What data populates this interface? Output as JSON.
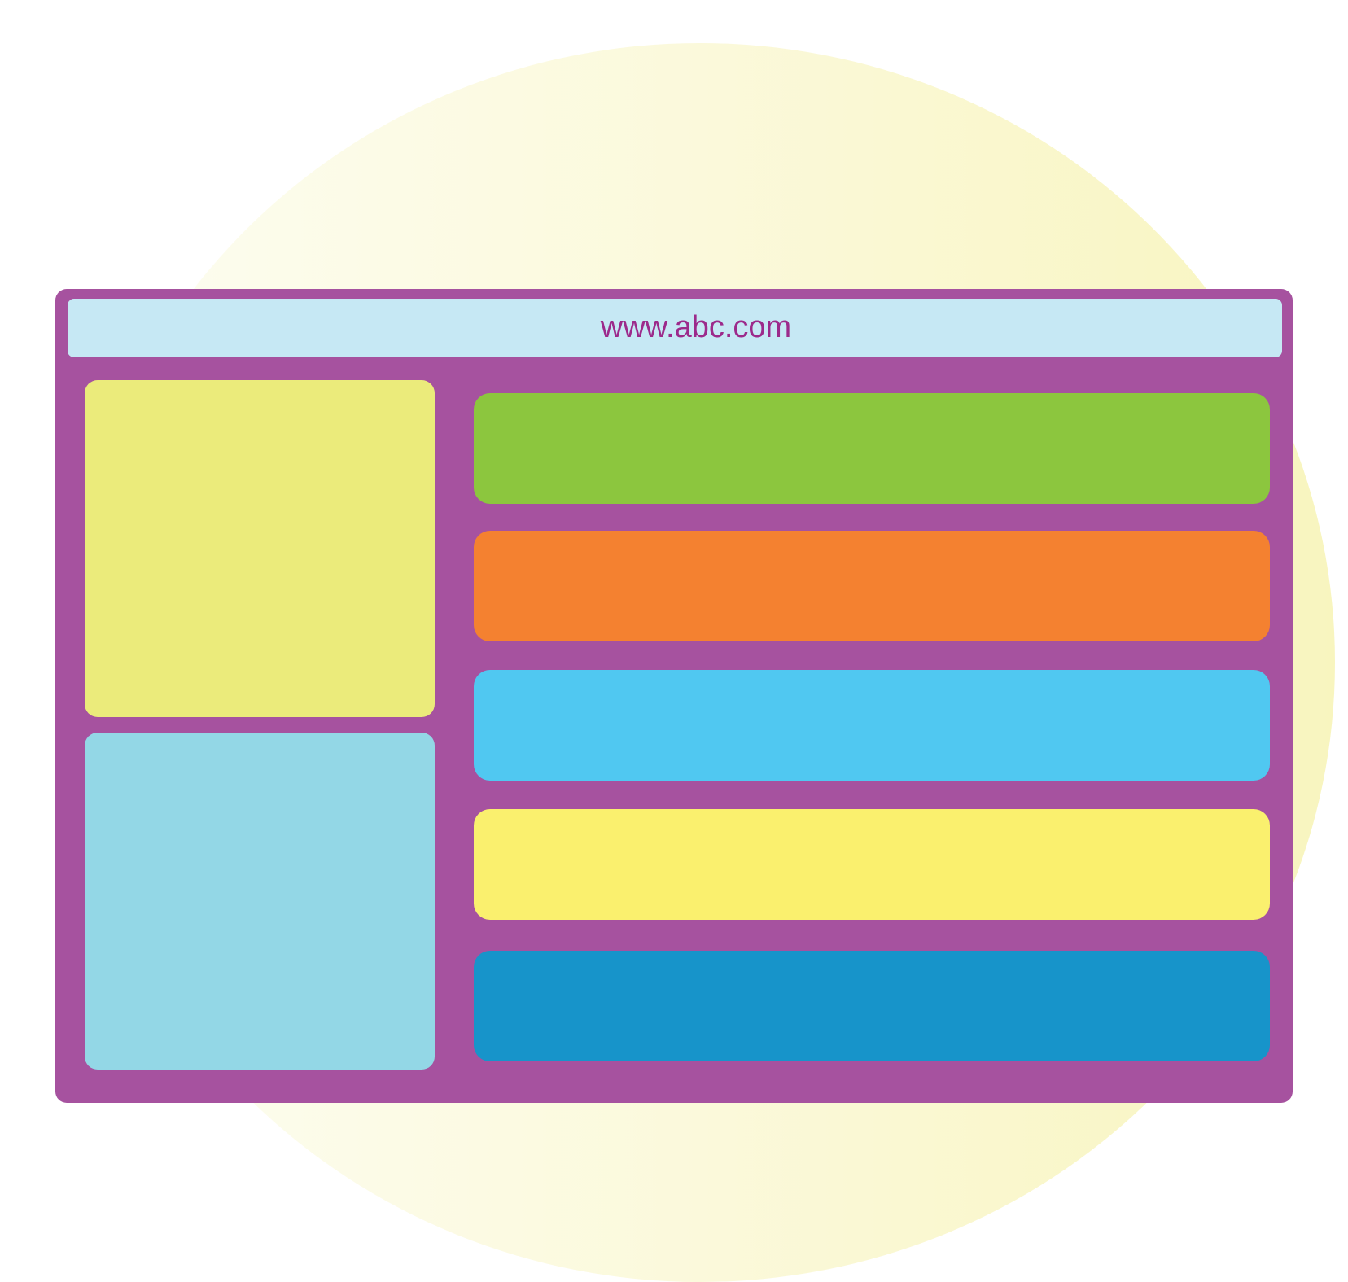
{
  "address_bar": {
    "url": "www.abc.com"
  },
  "colors": {
    "window_frame": "#a6529f",
    "address_bar_bg": "#c6e8f4",
    "url_text": "#9c2a8b",
    "left_panel_top": "#ebeb7b",
    "left_panel_bottom": "#93d7e6",
    "content_bars": [
      "#8cc63e",
      "#f48130",
      "#50c8f1",
      "#faf06e",
      "#1794ca"
    ]
  }
}
